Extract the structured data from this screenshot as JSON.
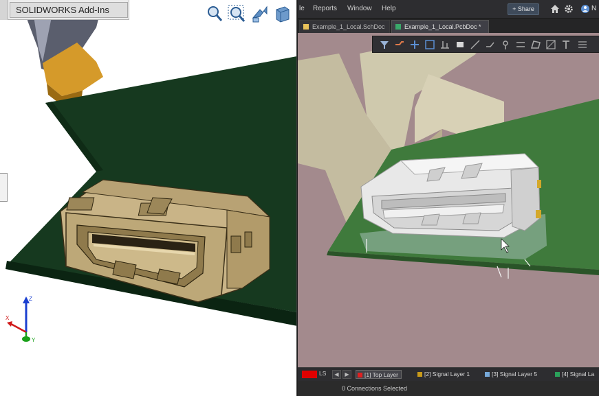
{
  "solidworks": {
    "tab_label": "SOLIDWORKS Add-Ins",
    "heads_up_icons": [
      "zoom-to-fit-icon",
      "zoom-to-area-icon",
      "previous-view-icon",
      "section-view-icon"
    ],
    "triad_axes": [
      "X",
      "Y",
      "Z"
    ],
    "colors": {
      "board": "#16391f",
      "connector": "#c9b487",
      "background": "#ffffff"
    }
  },
  "altium": {
    "menu": [
      "le",
      "Reports",
      "Window",
      "Help"
    ],
    "share_label": "Share",
    "menubar_icons": [
      "home-icon",
      "gear-icon",
      "user-icon"
    ],
    "user_initial": "N",
    "tabs": [
      {
        "label": "Example_1_Local.SchDoc",
        "active": false
      },
      {
        "label": "Example_1_Local.PcbDoc *",
        "active": true
      }
    ],
    "toolbar_icons": [
      "filter-icon",
      "route-icon",
      "add-icon",
      "select-rect-icon",
      "align-icon",
      "place-component-icon",
      "draw-line-icon",
      "track-icon",
      "pin-icon",
      "bus-icon",
      "polygon-icon",
      "dimension-icon",
      "text-icon",
      "more-icon"
    ],
    "status": {
      "current_layer_label": "LS",
      "layers": [
        {
          "label": "[1] Top Layer",
          "color": "#e02020",
          "active": true
        },
        {
          "label": "[2] Signal Layer 1",
          "color": "#c89a1a",
          "active": false
        },
        {
          "label": "[3] Signal Layer 5",
          "color": "#76a8d8",
          "active": false
        },
        {
          "label": "[4] Signal La",
          "color": "#2aa05a",
          "active": false
        }
      ],
      "connections": "0 Connections Selected"
    },
    "colors": {
      "viewport_bg": "#a38a8d",
      "board": "#3f7a3c",
      "connector": "#e8e8e8"
    }
  }
}
